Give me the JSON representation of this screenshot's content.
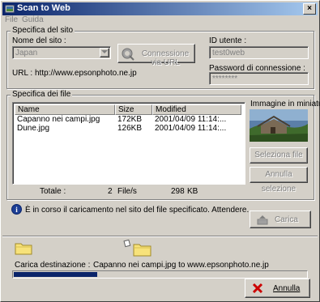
{
  "window": {
    "title": "Scan to Web",
    "close_glyph": "×"
  },
  "menu": [
    "File",
    "Guida"
  ],
  "site": {
    "group_label": "Specifica del sito",
    "site_name_label": "Nome del sito :",
    "site_name_value": "Japan",
    "connect_button": "Connessione via URL",
    "url_label": "URL :",
    "url_value": "http://www.epsonphoto.ne.jp",
    "user_id_label": "ID utente :",
    "user_id_value": "test0web",
    "password_label": "Password di connessione :",
    "password_value": "********"
  },
  "files": {
    "group_label": "Specifica dei file",
    "columns": [
      "Name",
      "Size",
      "Modified"
    ],
    "rows": [
      {
        "name": "Capanno nei campi.jpg",
        "size": "172KB",
        "modified": "2001/04/09 11:14:..."
      },
      {
        "name": "Dune.jpg",
        "size": "126KB",
        "modified": "2001/04/09 11:14:..."
      }
    ],
    "total_label": "Totale :",
    "total_count": "2",
    "files_unit": "File/s",
    "total_size": "298",
    "size_unit": "KB",
    "thumbnail_label": "Immagine in miniatura",
    "select_file_button": "Seleziona file",
    "cancel_selection_button": "Annulla selezione"
  },
  "status": {
    "info_icon_glyph": "i",
    "message": "È in corso il caricamento nel sito del file specificato. Attendere.",
    "upload_button": "Carica"
  },
  "transfer": {
    "destination_label": "Carica destinazione :",
    "destination_value": "Capanno nei campi.jpg to www.epsonphoto.ne.jp",
    "progress": 0.29,
    "cancel_button": "Annulla"
  },
  "colors": {
    "title_start": "#0a246a",
    "title_end": "#a6caf0",
    "progress_fill": "#0a246a",
    "cancel_x": "#cc0000"
  }
}
